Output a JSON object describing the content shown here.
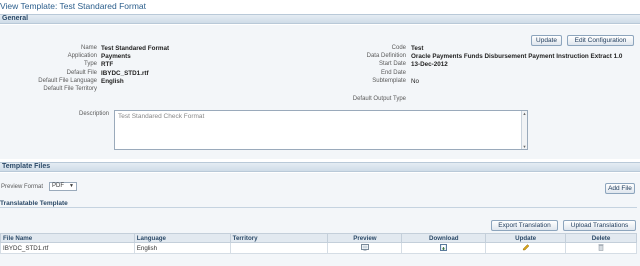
{
  "page": {
    "title": "View Template: Test Standared Format"
  },
  "general": {
    "section_title": "General",
    "update_label": "Update",
    "edit_config_label": "Edit Configuration",
    "left_fields": [
      {
        "label": "Name",
        "value": "Test Standared Format",
        "bold": true
      },
      {
        "label": "Application",
        "value": "Payments",
        "bold": true
      },
      {
        "label": "Type",
        "value": "RTF",
        "bold": true
      },
      {
        "label": "Default File",
        "value": "IBYDC_STD1.rtf",
        "bold": true
      },
      {
        "label": "Default File Language",
        "value": "English",
        "bold": true
      },
      {
        "label": "Default File Territory",
        "value": "",
        "bold": false
      }
    ],
    "right_fields": [
      {
        "label": "Code",
        "value": "Test",
        "bold": true
      },
      {
        "label": "Data Definition",
        "value": "Oracle Payments Funds Disbursement Payment Instruction Extract 1.0",
        "bold": true
      },
      {
        "label": "Start Date",
        "value": "13-Dec-2012",
        "bold": true
      },
      {
        "label": "End Date",
        "value": "",
        "bold": false
      },
      {
        "label": "Subtemplate",
        "value": "No",
        "bold": false
      }
    ],
    "default_output_type_label": "Default Output Type",
    "default_output_type_value": "",
    "description_label": "Description",
    "description_value": "Test Standared Check Format"
  },
  "template_files": {
    "section_title": "Template Files",
    "preview_format_label": "Preview Format",
    "preview_format_value": "PDF",
    "add_file_label": "Add File",
    "translatable_title": "Translatable Template",
    "export_translation_label": "Export Translation",
    "upload_translations_label": "Upload Translations",
    "columns": {
      "file_name": "File Name",
      "language": "Language",
      "territory": "Territory",
      "preview": "Preview",
      "download": "Download",
      "update": "Update",
      "delete": "Delete"
    },
    "rows": [
      {
        "file_name": "IBYDC_STD1.rtf",
        "language": "English",
        "territory": ""
      }
    ]
  },
  "icons": {
    "preview": "preview-icon",
    "download": "download-icon",
    "update": "pencil-icon",
    "delete": "trash-icon"
  },
  "colors": {
    "title_blue": "#2b5e8c",
    "header_bg": "#e2e9f0",
    "pencil": "#d7a21b"
  }
}
